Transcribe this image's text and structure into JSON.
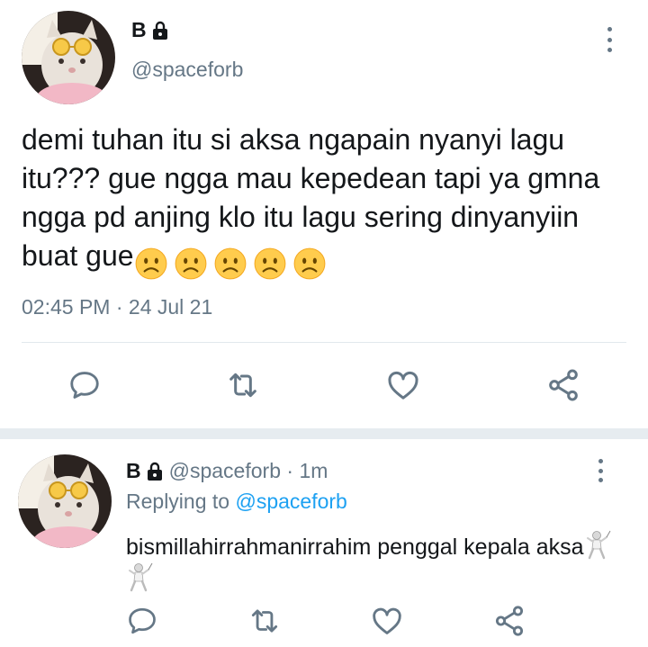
{
  "main_tweet": {
    "display_name": "B",
    "handle": "@spaceforb",
    "text": "demi tuhan itu si aksa ngapain nyanyi lagu itu??? gue ngga mau kepedean tapi ya gmna ngga pd anjing klo itu lagu sering dinyanyiin buat gue",
    "emoji": [
      "slightly-frowning-face",
      "slightly-frowning-face",
      "slightly-frowning-face",
      "slightly-frowning-face",
      "slightly-frowning-face"
    ],
    "time": "02:45 PM",
    "date": "24 Jul 21",
    "timestamp_sep": " · ",
    "actions": [
      "reply-icon",
      "retweet-icon",
      "like-icon",
      "share-icon"
    ]
  },
  "reply_tweet": {
    "display_name": "B",
    "handle": "@spaceforb",
    "age_sep": " · ",
    "age": "1m",
    "replying_prefix": "Replying to ",
    "replying_handle": "@spaceforb",
    "text": "bismillahirrahmanirrahim penggal kepala aksa",
    "emoji": [
      "person-fencing",
      "person-fencing"
    ],
    "actions": [
      "reply-icon",
      "retweet-icon",
      "like-icon",
      "share-icon"
    ]
  },
  "colors": {
    "text": "#14171a",
    "secondary": "#657786",
    "link": "#1da1f2",
    "divider": "#e1e8ed",
    "separator": "#e6ecf0"
  }
}
